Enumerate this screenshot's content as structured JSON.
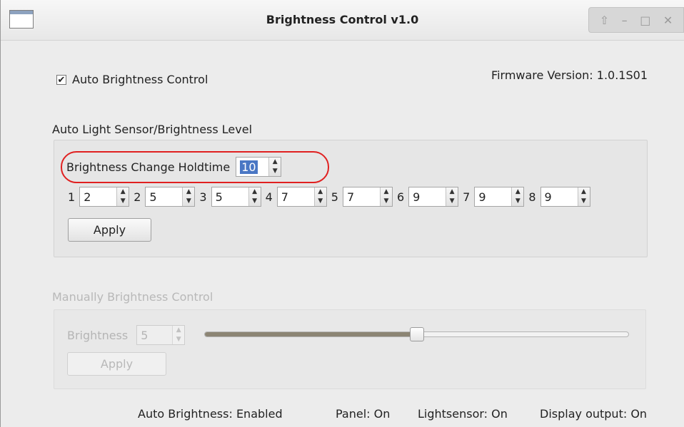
{
  "window": {
    "title": "Brightness Control v1.0",
    "controls": [
      "⇧",
      "–",
      "□",
      "✕"
    ]
  },
  "auto_control": {
    "checkbox_checked": true,
    "checkbox_mark": "✔",
    "label": "Auto Brightness Control",
    "firmware": "Firmware Version: 1.0.1S01"
  },
  "auto_section": {
    "title": "Auto Light Sensor/Brightness Level",
    "holdtime_label": "Brightness Change Holdtime",
    "holdtime_value": "10",
    "levels": [
      {
        "num": "1",
        "value": "2"
      },
      {
        "num": "2",
        "value": "5"
      },
      {
        "num": "3",
        "value": "5"
      },
      {
        "num": "4",
        "value": "7"
      },
      {
        "num": "5",
        "value": "7"
      },
      {
        "num": "6",
        "value": "9"
      },
      {
        "num": "7",
        "value": "9"
      },
      {
        "num": "8",
        "value": "9"
      }
    ],
    "apply_label": "Apply"
  },
  "manual_section": {
    "title": "Manually Brightness Control",
    "brightness_label": "Brightness",
    "brightness_value": "5",
    "slider_fraction": 0.5,
    "apply_label": "Apply"
  },
  "status": {
    "auto": "Auto Brightness: Enabled",
    "panel": "Panel: On",
    "lightsensor": "Lightsensor: On",
    "display": "Display output: On"
  },
  "colors": {
    "highlight": "#e02020",
    "selection": "#4a77c4",
    "slider_fill": "#8c8574"
  },
  "icons": {
    "spin_up": "▲",
    "spin_down": "▼"
  }
}
